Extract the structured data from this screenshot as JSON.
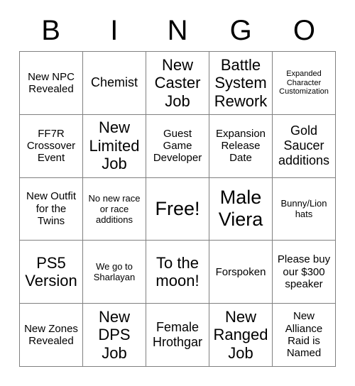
{
  "header": {
    "letters": [
      "B",
      "I",
      "N",
      "G",
      "O"
    ]
  },
  "grid": {
    "rows": 5,
    "columns": 5,
    "border_color": "#808080",
    "background_color": "#ffffff",
    "text_color": "#000000",
    "cells": [
      {
        "text": "New NPC Revealed",
        "size": "fs-sm"
      },
      {
        "text": "Chemist",
        "size": "fs-md"
      },
      {
        "text": "New Caster Job",
        "size": "fs-lg"
      },
      {
        "text": "Battle System Rework",
        "size": "fs-lg"
      },
      {
        "text": "Expanded Character Customization",
        "size": "fs-xxs"
      },
      {
        "text": "FF7R Crossover Event",
        "size": "fs-sm"
      },
      {
        "text": "New Limited Job",
        "size": "fs-lg"
      },
      {
        "text": "Guest Game Developer",
        "size": "fs-sm"
      },
      {
        "text": "Expansion Release Date",
        "size": "fs-sm"
      },
      {
        "text": "Gold Saucer additions",
        "size": "fs-md"
      },
      {
        "text": "New Outfit for the Twins",
        "size": "fs-sm"
      },
      {
        "text": "No new race or race additions",
        "size": "fs-xs"
      },
      {
        "text": "Free!",
        "size": "fs-xl"
      },
      {
        "text": "Male Viera",
        "size": "fs-xl"
      },
      {
        "text": "Bunny/Lion hats",
        "size": "fs-xs"
      },
      {
        "text": "PS5 Version",
        "size": "fs-lg"
      },
      {
        "text": "We go to Sharlayan",
        "size": "fs-xs"
      },
      {
        "text": "To the moon!",
        "size": "fs-lg"
      },
      {
        "text": "Forspoken",
        "size": "fs-sm"
      },
      {
        "text": "Please buy our $300 speaker",
        "size": "fs-sm"
      },
      {
        "text": "New Zones Revealed",
        "size": "fs-sm"
      },
      {
        "text": "New DPS Job",
        "size": "fs-lg"
      },
      {
        "text": "Female Hrothgar",
        "size": "fs-md"
      },
      {
        "text": "New Ranged Job",
        "size": "fs-lg"
      },
      {
        "text": "New Alliance Raid is Named",
        "size": "fs-sm"
      }
    ]
  }
}
